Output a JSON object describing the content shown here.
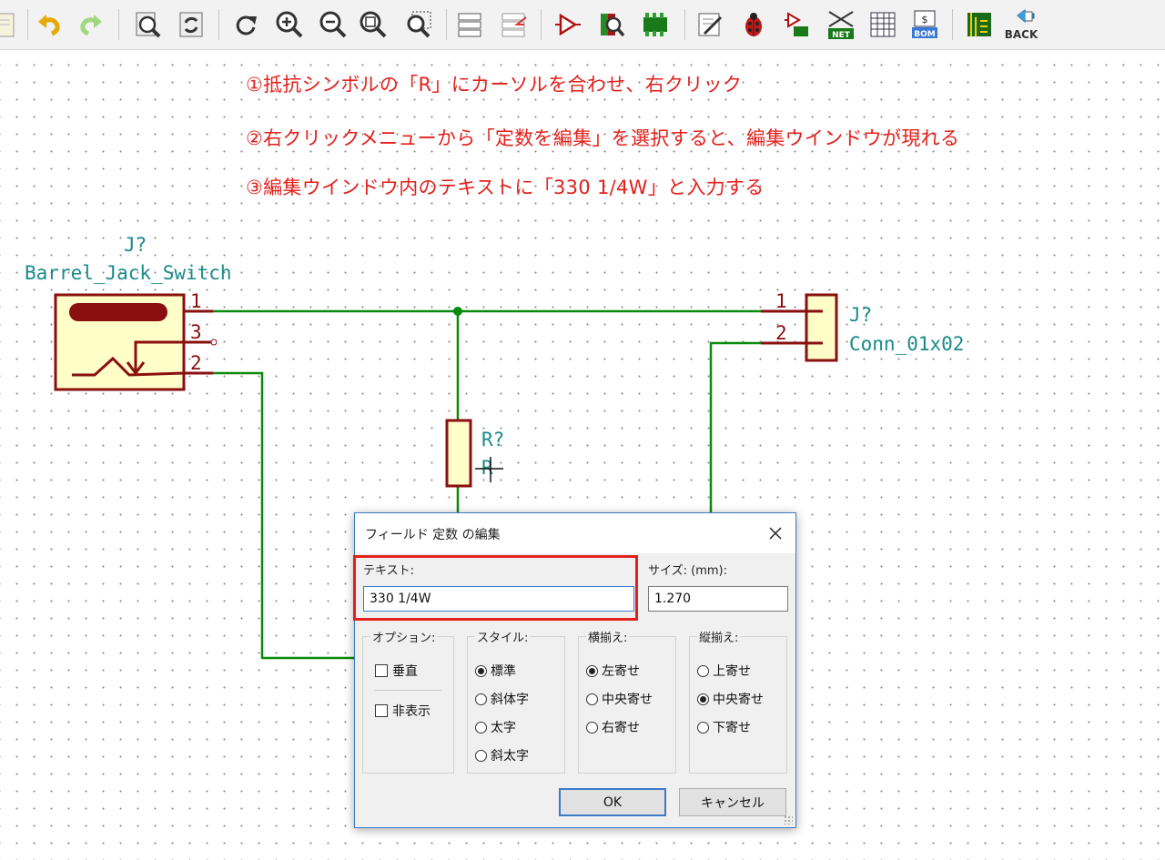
{
  "toolbar": {
    "icons": [
      "page-icon",
      "undo-icon",
      "redo-icon",
      "zoom-page-icon",
      "refresh-icon",
      "rotate-icon",
      "zoom-in-icon",
      "zoom-out-icon",
      "zoom-fit-icon",
      "zoom-selection-icon",
      "hierarchy-icon",
      "leave-sheet-icon",
      "symbol-editor-icon",
      "library-browser-icon",
      "footprint-assign-icon",
      "annotate-icon",
      "erc-icon",
      "netlist-icon",
      "netlist-export-icon",
      "bom-table-icon",
      "bom-icon",
      "pcbnew-icon",
      "back-icon"
    ],
    "net_label": "NET",
    "bom_label": "BOM",
    "bom_dollar": "$",
    "back_label": "BACK"
  },
  "instructions": [
    "①抵抗シンボルの「R」にカーソルを合わせ、右クリック",
    "②右クリックメニューから「定数を編集」を選択すると、編集ウインドウが現れる",
    "③編集ウインドウ内のテキストに「330 1/4W」と入力する"
  ],
  "schematic": {
    "barrel_ref": "J?",
    "barrel_value": "Barrel_Jack_Switch",
    "barrel_pins": [
      "1",
      "3",
      "2"
    ],
    "conn_ref": "J?",
    "conn_value": "Conn_01x02",
    "conn_pins": [
      "1",
      "2"
    ],
    "resistor_ref": "R?",
    "resistor_value": "R",
    "wire_color": "#0a8a0a",
    "symbol_outline_color": "#8a1010",
    "symbol_fill_color": "#fffdc8",
    "label_color": "#1a8a8a"
  },
  "dialog": {
    "title": "フィールド 定数 の編集",
    "text_label": "テキスト:",
    "text_value": "330 1/4W",
    "size_label": "サイズ: (mm):",
    "size_value": "1.270",
    "options": {
      "title": "オプション:",
      "items": [
        {
          "label": "垂直",
          "checked": false
        },
        {
          "label": "非表示",
          "checked": false
        }
      ]
    },
    "style": {
      "title": "スタイル:",
      "items": [
        {
          "label": "標準",
          "selected": true
        },
        {
          "label": "斜体字",
          "selected": false
        },
        {
          "label": "太字",
          "selected": false
        },
        {
          "label": "斜太字",
          "selected": false
        }
      ]
    },
    "halign": {
      "title": "横揃え:",
      "items": [
        {
          "label": "左寄せ",
          "selected": true
        },
        {
          "label": "中央寄せ",
          "selected": false
        },
        {
          "label": "右寄せ",
          "selected": false
        }
      ]
    },
    "valign": {
      "title": "縦揃え:",
      "items": [
        {
          "label": "上寄せ",
          "selected": false
        },
        {
          "label": "中央寄せ",
          "selected": true
        },
        {
          "label": "下寄せ",
          "selected": false
        }
      ]
    },
    "ok_label": "OK",
    "cancel_label": "キャンセル",
    "highlight_color": "#e3201b"
  }
}
